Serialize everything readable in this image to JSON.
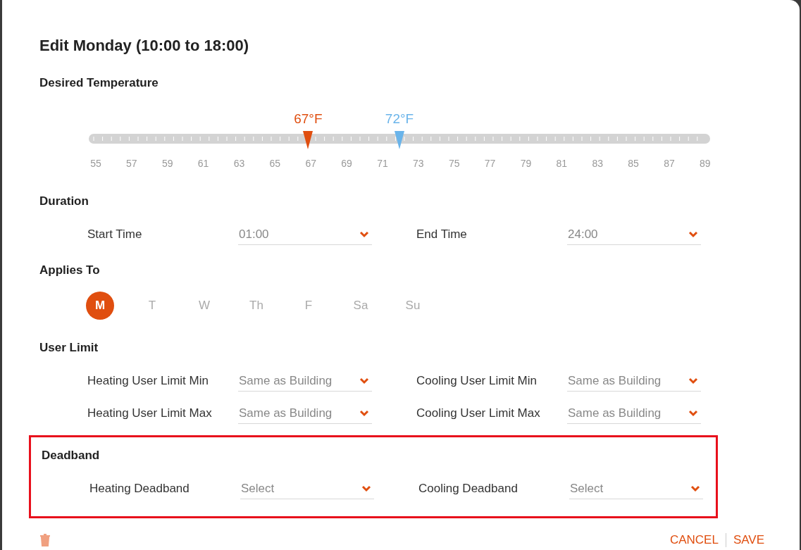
{
  "dialog": {
    "title": "Edit Monday (10:00 to 18:00)"
  },
  "temperature": {
    "heading": "Desired Temperature",
    "markers": [
      {
        "reading": "67°F",
        "level": 0.353,
        "color": "#e04e0f"
      },
      {
        "reading": "72°F",
        "level": 0.5,
        "color": "#6ab4ea"
      }
    ],
    "scale": [
      "55",
      "57",
      "59",
      "61",
      "63",
      "65",
      "67",
      "69",
      "71",
      "73",
      "75",
      "77",
      "79",
      "81",
      "83",
      "85",
      "87",
      "89"
    ]
  },
  "duration": {
    "heading": "Duration",
    "fields": [
      {
        "label": "Start Time",
        "value": "01:00"
      },
      {
        "label": "End Time",
        "value": "24:00"
      }
    ]
  },
  "applies_to": {
    "heading": "Applies To",
    "days": [
      {
        "label": "M",
        "selected": true
      },
      {
        "label": "T",
        "selected": false
      },
      {
        "label": "W",
        "selected": false
      },
      {
        "label": "Th",
        "selected": false
      },
      {
        "label": "F",
        "selected": false
      },
      {
        "label": "Sa",
        "selected": false
      },
      {
        "label": "Su",
        "selected": false
      }
    ]
  },
  "user_limit": {
    "heading": "User Limit",
    "fields": [
      {
        "label": "Heating User Limit Min",
        "value": "Same as Building"
      },
      {
        "label": "Cooling User Limit Min",
        "value": "Same as Building"
      },
      {
        "label": "Heating User Limit Max",
        "value": "Same as Building"
      },
      {
        "label": "Cooling User Limit Max",
        "value": "Same as Building"
      }
    ]
  },
  "deadband": {
    "heading": "Deadband",
    "highlighted": true,
    "fields": [
      {
        "label": "Heating Deadband",
        "placeholder": "Select"
      },
      {
        "label": "Cooling Deadband",
        "placeholder": "Select"
      }
    ]
  },
  "footer": {
    "buttons": [
      {
        "kind": "secondary",
        "label": "CANCEL"
      },
      {
        "kind": "primary",
        "label": "SAVE"
      }
    ]
  }
}
